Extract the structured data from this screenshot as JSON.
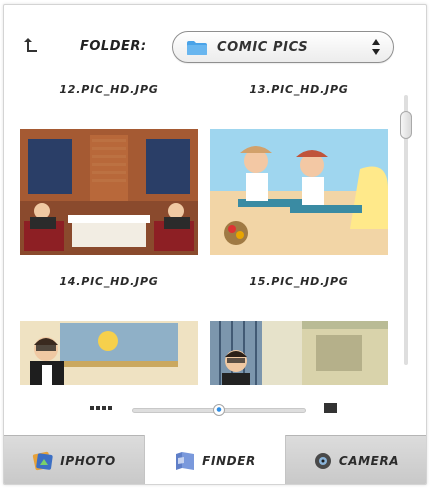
{
  "toolbar": {
    "folder_label": "FOLDER:",
    "folder_value": "COMIC PICS",
    "up_icon": "up-folder-icon"
  },
  "grid": {
    "top_labels": [
      "12.PIC_HD.JPG",
      "13.PIC_HD.JPG"
    ],
    "middle_labels": [
      "14.PIC_HD.JPG",
      "15.PIC_HD.JPG"
    ],
    "thumbnails": [
      {
        "name": "dinner-scene"
      },
      {
        "name": "beach-scene"
      },
      {
        "name": "office-scene"
      },
      {
        "name": "hallway-scene"
      }
    ]
  },
  "zoom": {
    "level": 0.5
  },
  "tabs": [
    {
      "label": "IPHOTO",
      "icon": "iphoto-icon",
      "active": false
    },
    {
      "label": "FINDER",
      "icon": "finder-icon",
      "active": true
    },
    {
      "label": "CAMERA",
      "icon": "camera-icon",
      "active": false
    }
  ],
  "colors": {
    "accent": "#2f8de4",
    "folder": "#4aa3e8"
  }
}
